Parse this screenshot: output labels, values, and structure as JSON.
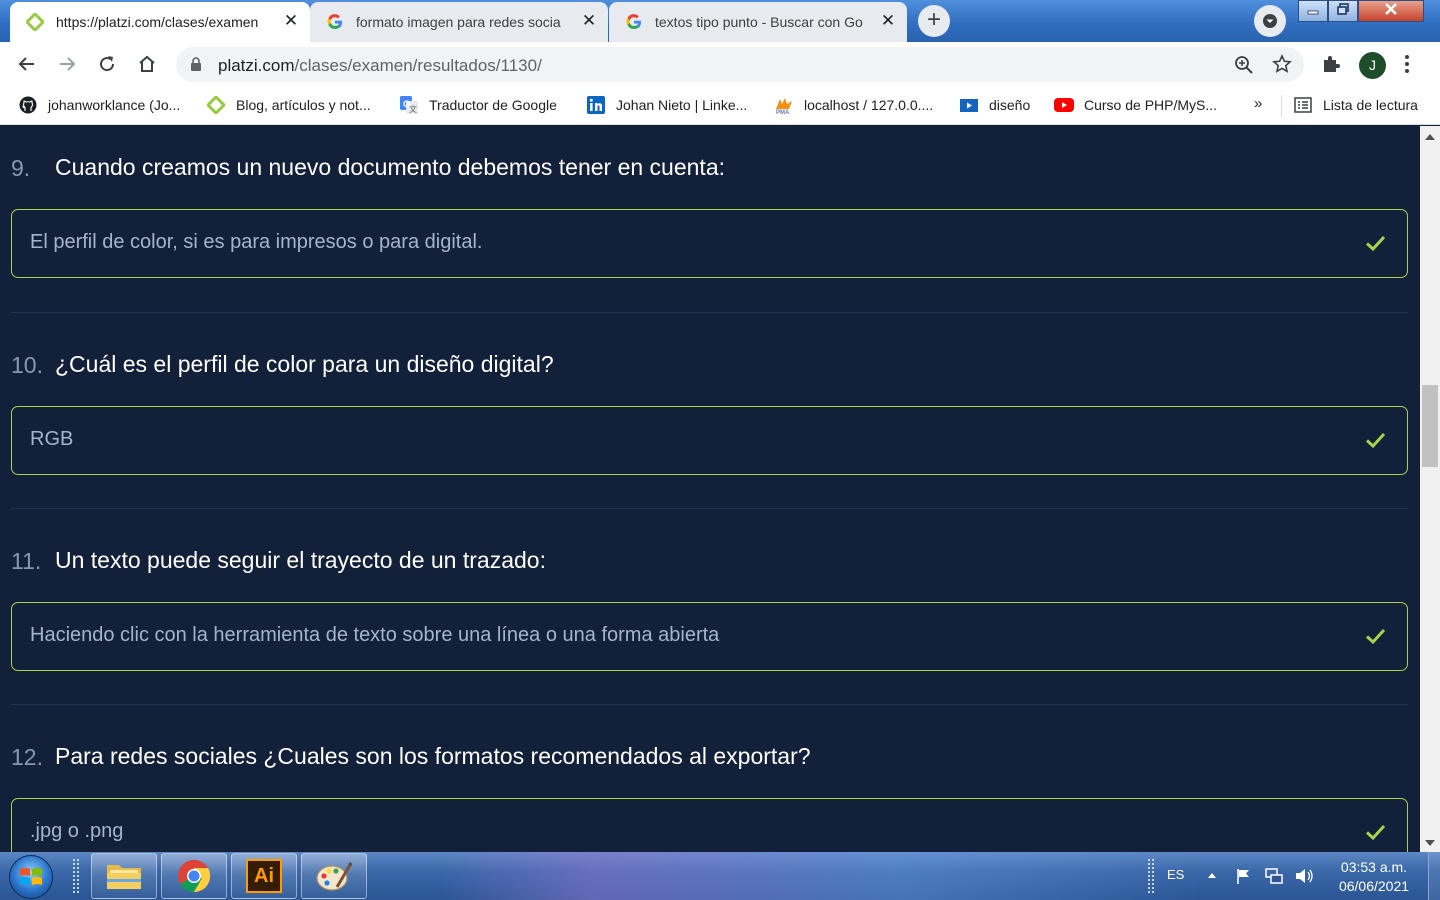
{
  "browser": {
    "tabs": [
      {
        "title": "https://platzi.com/clases/examen",
        "favicon": "platzi-icon",
        "active": true
      },
      {
        "title": "formato imagen para redes socia",
        "favicon": "google-icon",
        "active": false
      },
      {
        "title": "textos tipo punto - Buscar con Go",
        "favicon": "google-icon",
        "active": false
      }
    ],
    "close_glyph": "✕",
    "new_tab_glyph": "+",
    "address": {
      "domain": "platzi.com",
      "path": "/clases/examen/resultados/1130/"
    },
    "profile_initial": "J",
    "bookmarks": [
      {
        "label": "johanworklance (Jo...",
        "icon": "github-icon"
      },
      {
        "label": "Blog, artículos y not...",
        "icon": "platzi-icon"
      },
      {
        "label": "Traductor de Google",
        "icon": "google-translate-icon"
      },
      {
        "label": "Johan Nieto | Linke...",
        "icon": "linkedin-icon"
      },
      {
        "label": "localhost / 127.0.0....",
        "icon": "phpmyadmin-icon"
      },
      {
        "label": "diseño",
        "icon": "folder-video-icon"
      },
      {
        "label": "Curso de PHP/MyS...",
        "icon": "youtube-icon"
      }
    ],
    "bookmarks_more": "»",
    "reading_list": "Lista de lectura"
  },
  "exam": {
    "questions": [
      {
        "number": "9.",
        "text": "Cuando creamos un nuevo documento debemos tener en cuenta:",
        "answer": "El perfil de color, si es para impresos o para digital.",
        "correct": true
      },
      {
        "number": "10.",
        "text": "¿Cuál es el perfil de color para un diseño digital?",
        "answer": "RGB",
        "correct": true
      },
      {
        "number": "11.",
        "text": "Un texto puede seguir el trayecto de un trazado:",
        "answer": "Haciendo clic con la herramienta de texto sobre una línea o una forma abierta",
        "correct": true
      },
      {
        "number": "12.",
        "text": "Para redes sociales ¿Cuales son los formatos recomendados al exportar?",
        "answer": ".jpg o .png",
        "correct": true
      }
    ],
    "colors": {
      "background": "#13203a",
      "correct_border": "#a6d34b",
      "answer_text": "#a5b4cc"
    }
  },
  "taskbar": {
    "apps": [
      "windows-explorer-icon",
      "chrome-icon",
      "illustrator-icon",
      "paint-icon"
    ],
    "illustrator_label": "Ai",
    "language": "ES",
    "time": "03:53 a.m.",
    "date": "06/06/2021"
  }
}
